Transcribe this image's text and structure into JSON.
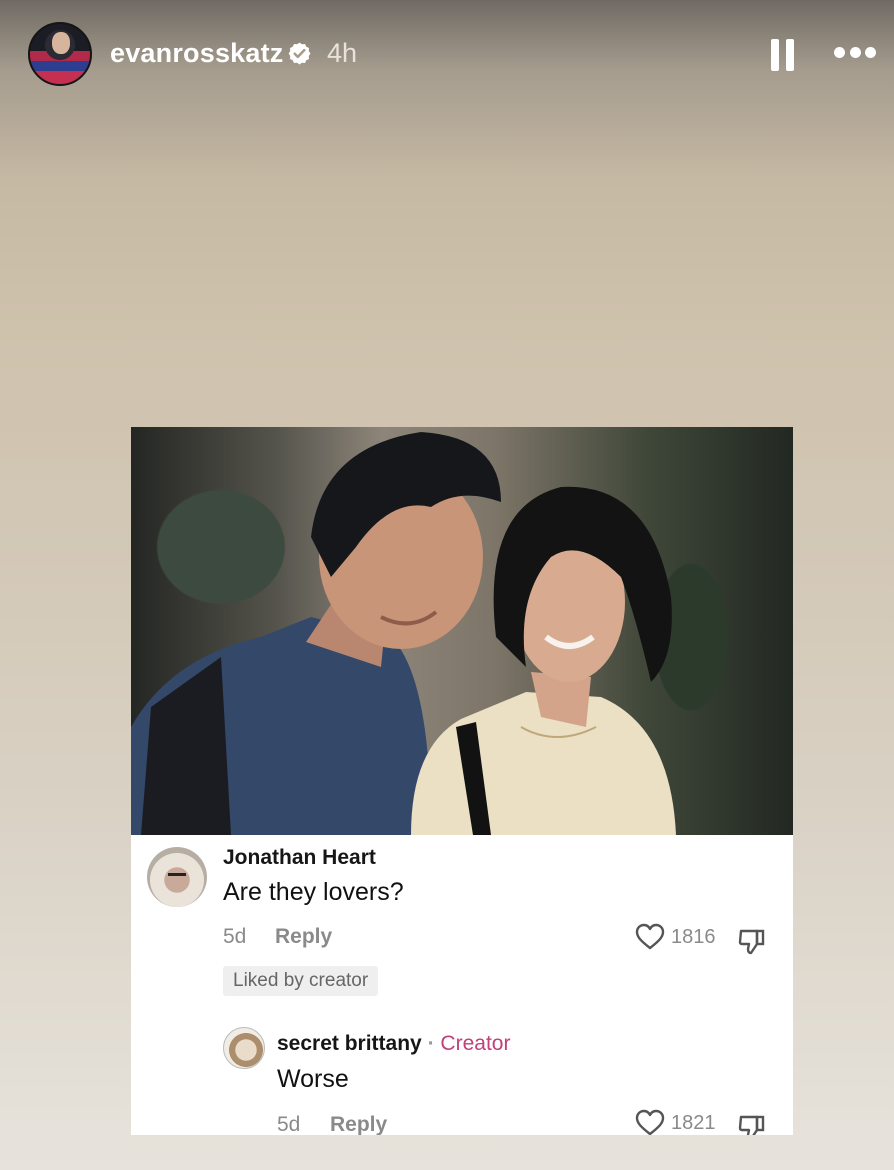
{
  "story": {
    "username": "evanrosskatz",
    "time": "4h"
  },
  "post": {
    "comment1": {
      "author": "Jonathan Heart",
      "text": "Are they lovers?",
      "age": "5d",
      "reply_label": "Reply",
      "likes": "1816",
      "liked_badge": "Liked by creator"
    },
    "comment2": {
      "author": "secret brittany",
      "separator": "·",
      "badge": "Creator",
      "text": "Worse",
      "age": "5d",
      "reply_label": "Reply",
      "likes": "1821"
    }
  }
}
